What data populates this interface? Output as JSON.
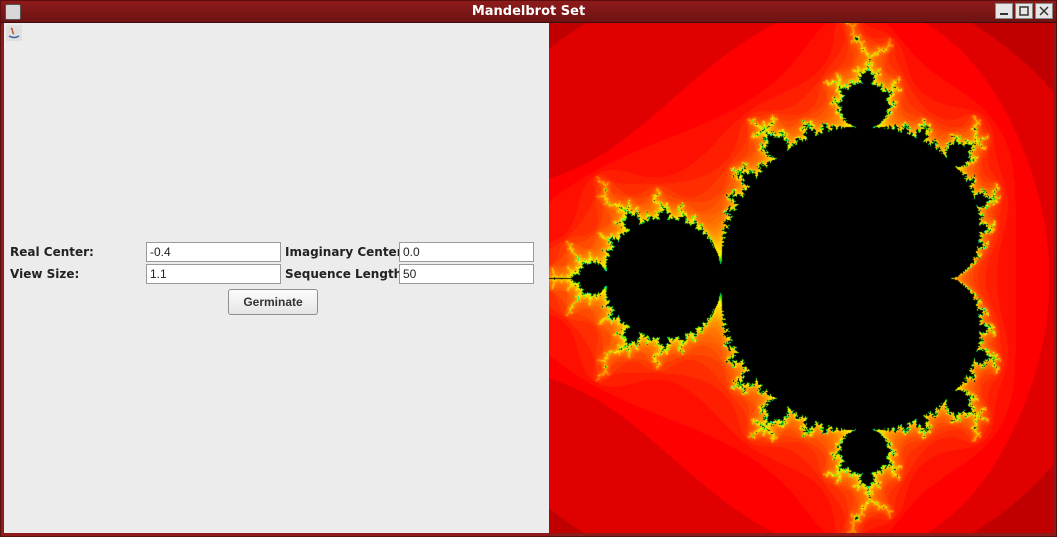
{
  "window": {
    "title": "Mandelbrot Set"
  },
  "form": {
    "real_center": {
      "label": "Real Center:",
      "value": "-0.4"
    },
    "imaginary_center": {
      "label": "Imaginary Center:",
      "value": "0.0"
    },
    "view_size": {
      "label": "View Size:",
      "value": "1.1"
    },
    "sequence_length": {
      "label": "Sequence Length:",
      "value": "50"
    },
    "action_label": "Germinate"
  },
  "fractal": {
    "real_center": -0.4,
    "imag_center": 0.0,
    "view_size": 1.1,
    "max_iter": 50
  }
}
